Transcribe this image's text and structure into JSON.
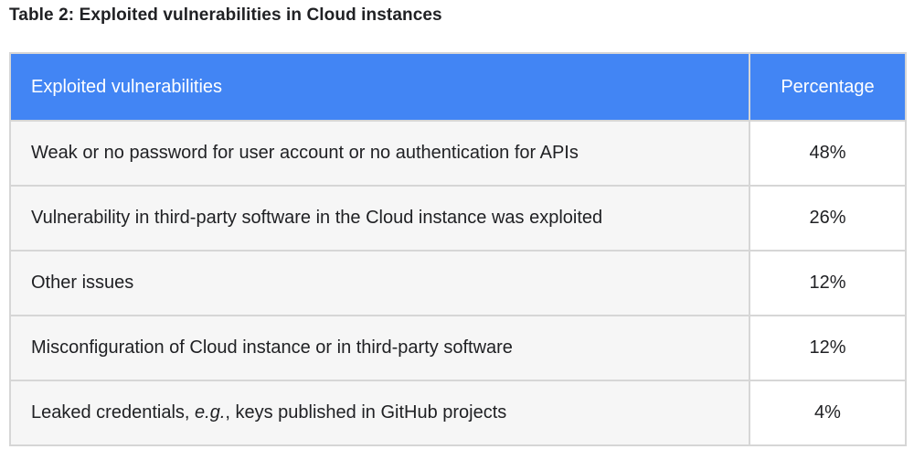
{
  "caption": "Table 2: Exploited vulnerabilities in Cloud instances",
  "table": {
    "headers": [
      "Exploited vulnerabilities",
      "Percentage"
    ],
    "rows": [
      {
        "vuln": "Weak or no password for user account or no authentication for APIs",
        "pct": "48%"
      },
      {
        "vuln": "Vulnerability in third-party software in the Cloud instance was exploited",
        "pct": "26%"
      },
      {
        "vuln": "Other issues",
        "pct": "12%"
      },
      {
        "vuln": "Misconfiguration of Cloud instance or in third-party software",
        "pct": "12%"
      },
      {
        "vuln_prefix": "Leaked credentials, ",
        "vuln_em": "e.g.",
        "vuln_suffix": ", keys published in GitHub projects",
        "pct": "4%"
      }
    ]
  },
  "colors": {
    "header_bg": "#4285f4",
    "header_text": "#ffffff",
    "row_bg": "#f6f6f6",
    "border": "#d6d6d6"
  }
}
